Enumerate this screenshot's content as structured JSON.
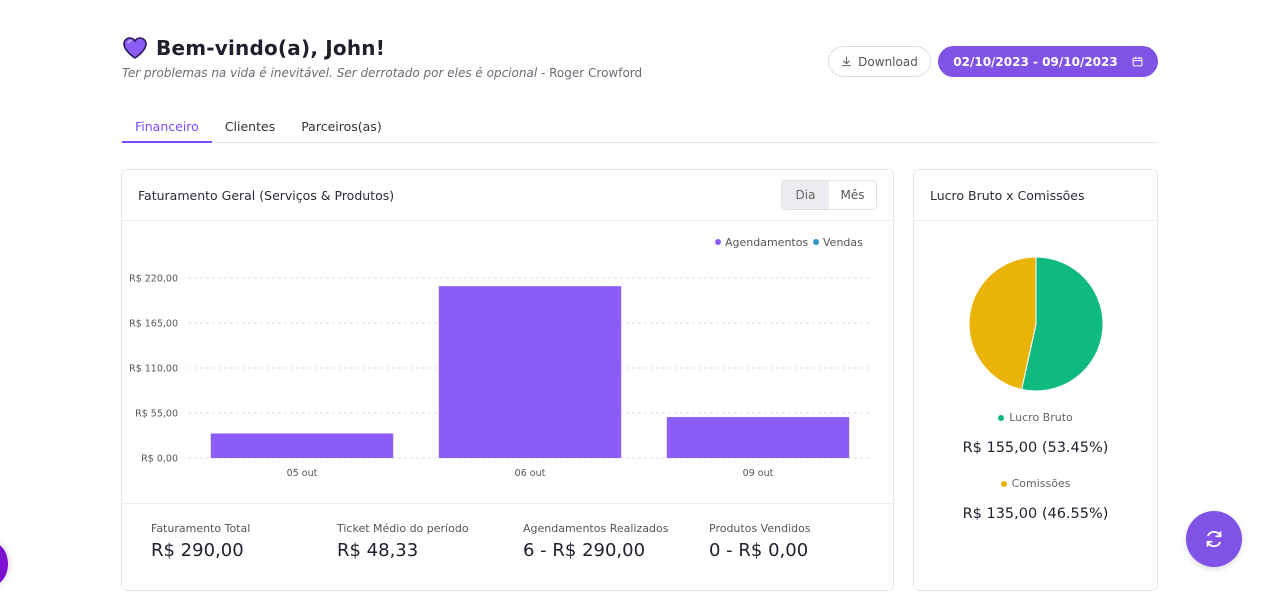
{
  "header": {
    "welcome": "Bem-vindo(a), John!",
    "quote": "Ter problemas na vida é inevitável. Ser derrotado por eles é opcional",
    "author": "- Roger Crowford",
    "download_label": "Download",
    "date_range": "02/10/2023 - 09/10/2023",
    "heart_icon": "purple-heart-icon",
    "download_icon": "download-icon",
    "calendar_icon": "calendar-icon"
  },
  "tabs": [
    {
      "label": "Financeiro",
      "active": true
    },
    {
      "label": "Clientes",
      "active": false
    },
    {
      "label": "Parceiros(as)",
      "active": false
    }
  ],
  "main_card": {
    "title": "Faturamento Geral (Serviços & Produtos)",
    "toggle": [
      {
        "label": "Dia",
        "active": true
      },
      {
        "label": "Mês",
        "active": false
      }
    ]
  },
  "chart_data": {
    "type": "bar",
    "categories": [
      "05 out",
      "06 out",
      "09 out"
    ],
    "series": [
      {
        "name": "Agendamentos",
        "color": "#8b5cf6",
        "values": [
          30,
          210,
          50
        ]
      },
      {
        "name": "Vendas",
        "color": "#2e93c9",
        "values": [
          0,
          0,
          0
        ]
      }
    ],
    "y_ticks": [
      "R$ 0,00",
      "R$ 55,00",
      "R$ 110,00",
      "R$ 165,00",
      "R$ 220,00"
    ],
    "y_tick_values": [
      0,
      55,
      110,
      165,
      220
    ],
    "ylim": [
      0,
      220
    ],
    "grid": true,
    "legend_position": "top-right"
  },
  "stats": [
    {
      "label": "Faturamento Total",
      "value": "R$ 290,00"
    },
    {
      "label": "Ticket Médio do período",
      "value": "R$ 48,33"
    },
    {
      "label": "Agendamentos Realizados",
      "value": "6 - R$ 290,00"
    },
    {
      "label": "Produtos Vendidos",
      "value": "0 - R$ 0,00"
    }
  ],
  "side_card": {
    "title": "Lucro Bruto x Comissões",
    "pie": [
      {
        "label": "Lucro Bruto",
        "amount": 155,
        "percent": 53.45,
        "color": "#10b981",
        "display": "R$ 155,00 (53.45%)"
      },
      {
        "label": "Comissões",
        "amount": 135,
        "percent": 46.55,
        "color": "#eab308",
        "display": "R$ 135,00 (46.55%)"
      }
    ]
  },
  "fab_icon": "refresh-icon"
}
